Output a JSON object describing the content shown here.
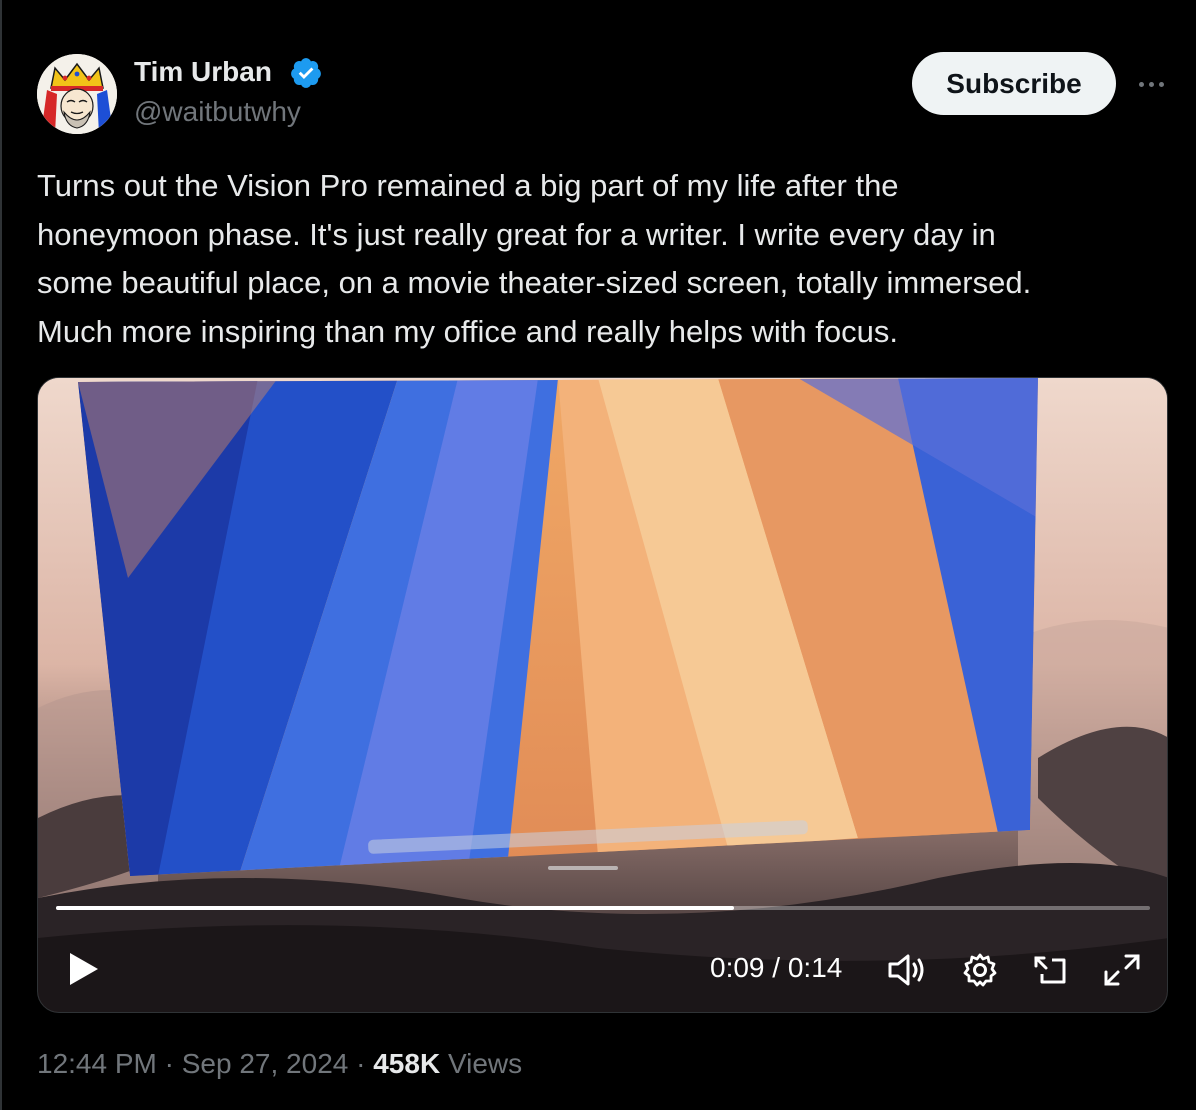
{
  "author": {
    "name": "Tim Urban",
    "handle": "@waitbutwhy",
    "verified_icon": "verified-badge-icon",
    "avatar": "king-of-hearts-card-avatar"
  },
  "header": {
    "subscribe_label": "Subscribe",
    "more_icon": "more-horizontal-icon"
  },
  "tweet": {
    "lines": [
      "Turns out the Vision Pro remained a big part of my life after the",
      "honeymoon phase. It's just really great for a writer. I write every day in",
      "some beautiful place, on a movie theater-sized screen, totally immersed.",
      "Much more inspiring than my office and really helps with focus."
    ]
  },
  "video": {
    "current_time": "0:09",
    "separator": "/",
    "duration": "0:14",
    "progress_fraction": 0.62,
    "controls": [
      "play-icon",
      "volume-icon",
      "settings-gear-icon",
      "picture-in-picture-icon",
      "fullscreen-icon"
    ]
  },
  "footer": {
    "time": "12:44 PM",
    "date": "Sep 27, 2024",
    "views_count": "458K",
    "views_label": "Views",
    "dot": "·"
  },
  "colors": {
    "background": "#000000",
    "text_primary": "#e7e9ea",
    "text_secondary": "#71767b",
    "verified_blue": "#1d9bf0",
    "button_bg": "#eff3f4"
  }
}
